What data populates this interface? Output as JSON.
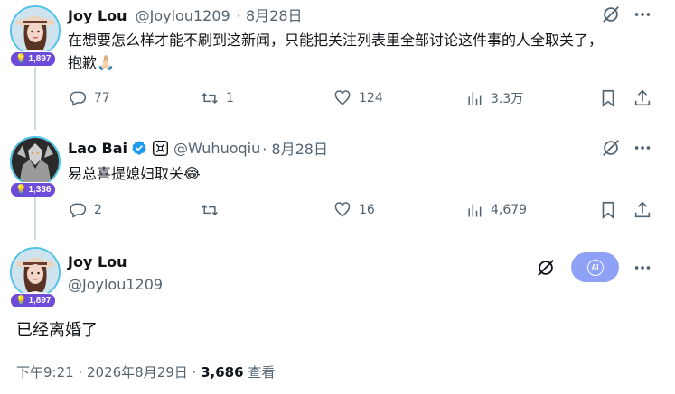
{
  "tweets": [
    {
      "name": "Joy Lou",
      "handle": "@Joylou1209",
      "date": "· 8月28日",
      "text": "在想要怎么样才能不刷到这新闻，只能把关注列表里全部讨论这件事的人全取关了，抱歉🙏🏻",
      "badge": "1,897",
      "replies": "77",
      "retweets": "1",
      "likes": "124",
      "views": "3.3万"
    },
    {
      "name": "Lao Bai",
      "handle": "@Wuhuoqiu",
      "date": "· 8月28日",
      "text": "易总喜提媳妇取关😂",
      "badge": "1,336",
      "replies": "2",
      "retweets": "",
      "likes": "16",
      "views": "4,679"
    }
  ],
  "main_tweet": {
    "name": "Joy Lou",
    "handle": "@Joylou1209",
    "badge": "1,897",
    "text": "已经离婚了",
    "time": "下午9:21 · 2026年8月29日 · ",
    "view_count": "3,686",
    "view_label": " 查看",
    "ai_label": "AI"
  },
  "colors": {
    "thread_line": "#cfd9de",
    "badge": "#6c4cd8",
    "verified": "#1d9bf0",
    "ai_button": "#8fa1f7",
    "muted_text": "#536471"
  }
}
